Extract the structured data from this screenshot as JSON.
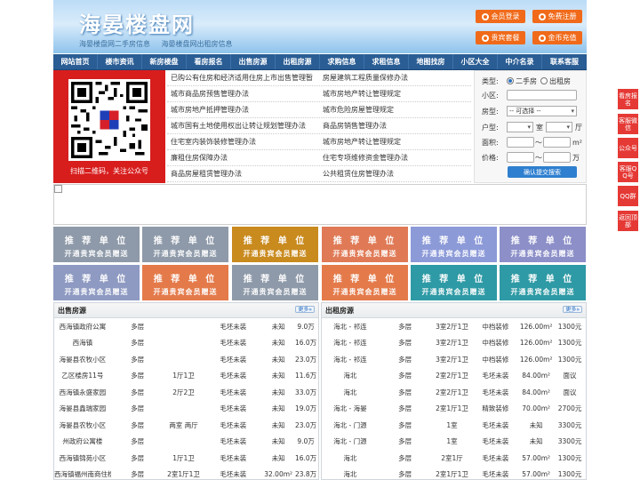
{
  "header": {
    "site_title": "海晏楼盘网",
    "subtitle_links": [
      "海晏楼盘网二手房信息",
      "海晏楼盘网出租房信息"
    ],
    "buttons": [
      {
        "label": "会员登录",
        "icon": "user-icon"
      },
      {
        "label": "免费注册",
        "icon": "register-icon"
      },
      {
        "label": "贵宾套餐",
        "icon": "vip-icon"
      },
      {
        "label": "金币充值",
        "icon": "coin-icon"
      }
    ]
  },
  "nav": [
    "网站首页",
    "楼市资讯",
    "新房楼盘",
    "看房报名",
    "出售房源",
    "出租房源",
    "求购信息",
    "求租信息",
    "地图找房",
    "小区大全",
    "中介名录",
    "联系客服"
  ],
  "qr": {
    "caption": "扫描二维码，关注公众号"
  },
  "news": [
    [
      "已购公有住房和经济适用住房上市出售管理暂",
      "房屋建筑工程质量保修办法"
    ],
    [
      "城市商品房预售管理办法",
      "城市房地产转让管理规定"
    ],
    [
      "城市房地产抵押管理办法",
      "城市危险房屋管理规定"
    ],
    [
      "城市国有土地使用权出让转让规划管理办法",
      "商品房销售管理办法"
    ],
    [
      "住宅室内装饰装修管理办法",
      "城市房地产转让管理规定"
    ],
    [
      "廉租住房保障办法",
      "住宅专项维修资金管理办法"
    ],
    [
      "商品房屋租赁管理办法",
      "公共租赁住房管理办法"
    ]
  ],
  "search": {
    "type_label": "类型:",
    "type_options": [
      {
        "label": "二手房",
        "checked": true
      },
      {
        "label": "出租房",
        "checked": false
      }
    ],
    "community_label": "小区:",
    "community_value": "",
    "layout_label": "房型:",
    "layout_value": "-- 可选择 --",
    "rooms_label": "户型:",
    "rooms_value": "",
    "room_unit": "室",
    "hall_value": "",
    "hall_unit": "厅",
    "area_label": "面积:",
    "area_sep": "～",
    "area_unit": "m²",
    "price_label": "价格:",
    "price_sep": "～",
    "price_unit": "万",
    "submit_label": "确认提交搜索"
  },
  "ads": {
    "line1": "推 荐 单 位",
    "line2": "开通贵宾会员赠送",
    "colors": [
      "#8e9aa9",
      "#8e9aa9",
      "#c98a1e",
      "#e07a56",
      "#8c9ad8",
      "#8c8fc8",
      "#8e9ac2",
      "#e47a4a",
      "#8e9aa9",
      "#e47a4a",
      "#2e9aa5",
      "#2e9aa5"
    ]
  },
  "sale": {
    "title": "出售房源",
    "more": "更多»",
    "rows": [
      [
        "西海镇政府公寓",
        "多层",
        "",
        "毛坯未装",
        "未知",
        "9.0万"
      ],
      [
        "西海镇",
        "多层",
        "",
        "毛坯未装",
        "未知",
        "16.0万"
      ],
      [
        "海晏县农牧小区",
        "多层",
        "",
        "毛坯未装",
        "未知",
        "23.0万"
      ],
      [
        "乙区楼房11号",
        "多层",
        "1厅1卫",
        "毛坯未装",
        "未知",
        "11.6万"
      ],
      [
        "西海镇永盛家园",
        "多层",
        "2厅2卫",
        "毛坯未装",
        "未知",
        "33.0万"
      ],
      [
        "海晏县鑫瑞家园",
        "多层",
        "",
        "毛坯未装",
        "未知",
        "19.0万"
      ],
      [
        "海晏县农牧小区",
        "多层",
        "两室 两厅",
        "毛坯未装",
        "未知",
        "23.0万"
      ],
      [
        "州政府公寓楼",
        "多层",
        "",
        "毛坯未装",
        "未知",
        "9.0万"
      ],
      [
        "西海镇锦苑小区",
        "多层",
        "1厅1卫",
        "毛坯未装",
        "未知",
        "16.0万"
      ],
      [
        "西海镇福州南商住楼",
        "多层",
        "2室1厅1卫",
        "毛坯未装",
        "32.00m²",
        "23.8万"
      ]
    ]
  },
  "rent": {
    "title": "出租房源",
    "more": "更多»",
    "rows": [
      [
        "海北 - 祁连",
        "多层",
        "3室2厅1卫",
        "中档装修",
        "126.00m²",
        "1300元"
      ],
      [
        "海北 - 祁连",
        "多层",
        "3室2厅1卫",
        "中档装修",
        "126.00m²",
        "1300元"
      ],
      [
        "海北 - 祁连",
        "多层",
        "3室2厅1卫",
        "中档装修",
        "126.00m²",
        "1300元"
      ],
      [
        "海北",
        "多层",
        "2室2厅1卫",
        "毛坯未装",
        "84.00m²",
        "面议"
      ],
      [
        "海北",
        "多层",
        "2室2厅1卫",
        "毛坯未装",
        "84.00m²",
        "面议"
      ],
      [
        "海北 - 海晏",
        "多层",
        "2室1厅1卫",
        "精致装修",
        "70.00m²",
        "2700元"
      ],
      [
        "海北 - 门源",
        "多层",
        "1室",
        "毛坯未装",
        "未知",
        "3300元"
      ],
      [
        "海北 - 门源",
        "多层",
        "1室",
        "毛坯未装",
        "未知",
        "3300元"
      ],
      [
        "海北",
        "多层",
        "2室1厅",
        "毛坯未装",
        "57.00m²",
        "1300元"
      ],
      [
        "海北",
        "多层",
        "2室1厅1卫",
        "毛坯未装",
        "57.00m²",
        "1300元"
      ]
    ]
  },
  "floats": [
    "看房报名",
    "客服微信",
    "公众号",
    "客服QQ号",
    "QQ群",
    "返回顶部"
  ]
}
